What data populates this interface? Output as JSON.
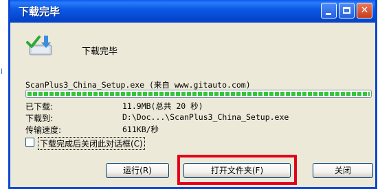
{
  "window": {
    "title": "下载完毕",
    "controls": {
      "minimize": "minimize",
      "maximize": "maximize",
      "close": "✕"
    },
    "title_bar_color": "#0a5ae6",
    "close_button_color": "#d4502b"
  },
  "main": {
    "icon": "download-complete-icon",
    "heading": "下载完毕",
    "filename_line": "ScanPlus3_China_Setup.exe (来自 www.gitauto.com)",
    "progress": {
      "fraction": 1.0,
      "color": "#37c33d"
    },
    "info": [
      {
        "label": "已下载:",
        "value": "11.9MB(总共 20 秒)"
      },
      {
        "label": "下载到:",
        "value": "D:\\Doc...\\ScanPlus3_China_Setup.exe"
      },
      {
        "label": "传输速度:",
        "value": "611KB/秒"
      }
    ],
    "checkbox": {
      "label": "下载完成后关闭此对话框(C)",
      "checked": false
    }
  },
  "buttons": {
    "run": "运行(R)",
    "open_folder": "打开文件夹(F)",
    "close": "关闭"
  },
  "highlight_color": "#e3001b"
}
